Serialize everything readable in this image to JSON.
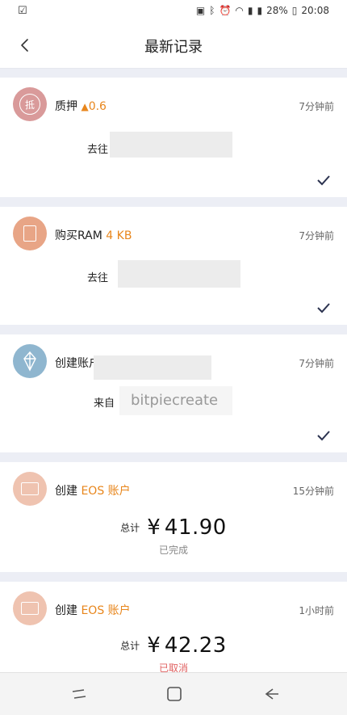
{
  "status_bar": {
    "battery": "28%",
    "time": "20:08"
  },
  "header": {
    "title": "最新记录"
  },
  "records": [
    {
      "action": "质押",
      "amount": "0.6",
      "time": "7分钟前",
      "row_label": "去往"
    },
    {
      "action": "购买RAM",
      "amount": "4 KB",
      "time": "7分钟前",
      "row_label": "去往"
    },
    {
      "action": "创建账户",
      "time": "7分钟前",
      "row_label": "来自",
      "row_value": "bitpiecreate"
    },
    {
      "action": "创建",
      "token": "EOS 账户",
      "time": "15分钟前",
      "total_label": "总计",
      "currency": "¥",
      "total": "41.90",
      "status": "已完成"
    },
    {
      "action": "创建",
      "token": "EOS 账户",
      "time": "1小时前",
      "total_label": "总计",
      "currency": "¥",
      "total": "42.23",
      "status": "已取消"
    }
  ],
  "colors": {
    "accent": "#e8861c",
    "status_done": "#888888",
    "status_cancelled": "#e06060",
    "avatar_stake": "#d99a9a",
    "avatar_ram": "#e8a586",
    "avatar_eos": "#8fb6cf",
    "avatar_card": "#efc3b0"
  }
}
